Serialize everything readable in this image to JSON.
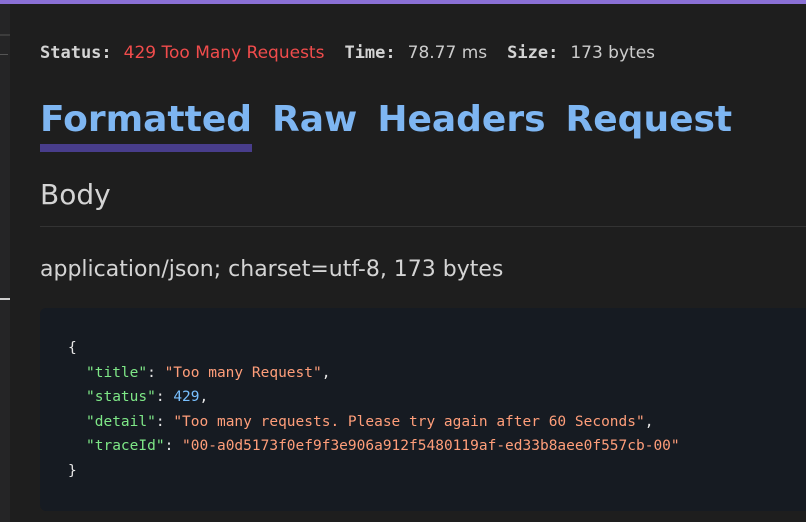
{
  "status_bar": {
    "status_label": "Status:",
    "status_value": "429 Too Many Requests",
    "time_label": "Time:",
    "time_value": "78.77 ms",
    "size_label": "Size:",
    "size_value": "173 bytes",
    "colors": {
      "error": "#f14c4c"
    }
  },
  "tabs": [
    {
      "label": "Formatted",
      "active": true
    },
    {
      "label": "Raw",
      "active": false
    },
    {
      "label": "Headers",
      "active": false
    },
    {
      "label": "Request",
      "active": false
    }
  ],
  "body": {
    "section_title": "Body",
    "content_type": "application/json; charset=utf-8, 173 bytes",
    "json": {
      "open_brace": "{",
      "close_brace": "}",
      "lines": [
        {
          "key": "\"title\"",
          "value": "\"Too many Request\"",
          "type": "string",
          "comma": ","
        },
        {
          "key": "\"status\"",
          "value": "429",
          "type": "number",
          "comma": ","
        },
        {
          "key": "\"detail\"",
          "value": "\"Too many requests. Please try again after 60 Seconds\"",
          "type": "string",
          "comma": ","
        },
        {
          "key": "\"traceId\"",
          "value": "\"00-a0d5173f0ef9f3e906a912f5480119af-ed33b8aee0f557cb-00\"",
          "type": "string",
          "comma": ""
        }
      ]
    }
  },
  "accent_color": "#8a70d6"
}
